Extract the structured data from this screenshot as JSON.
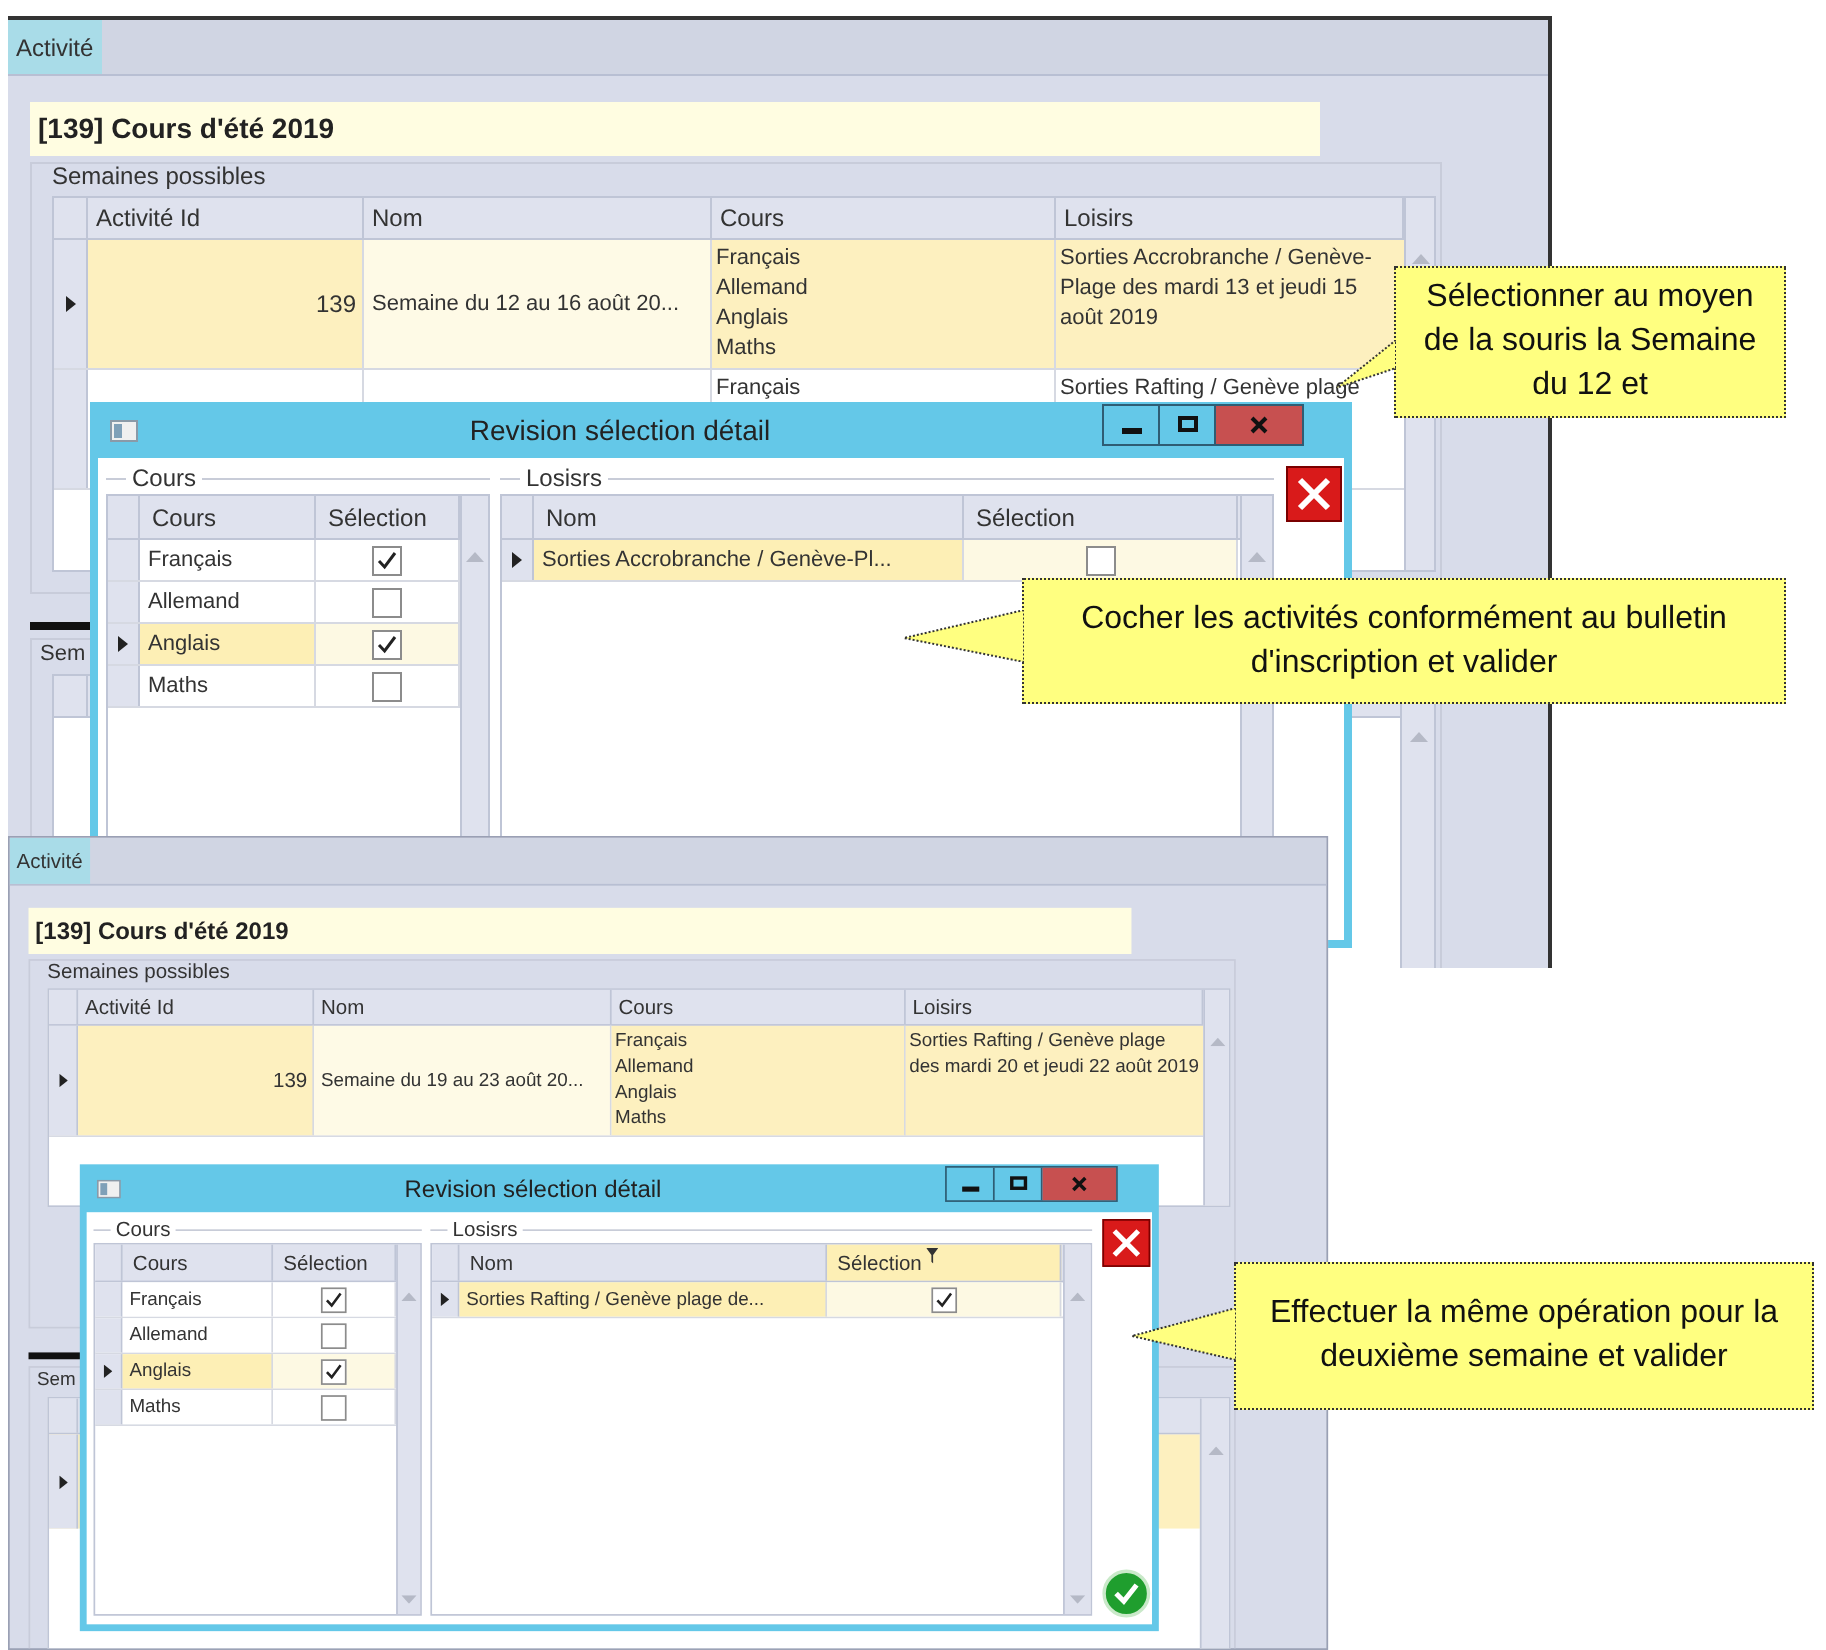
{
  "screens": [
    {
      "tab": "Activité",
      "title": "[139] Cours d'été 2019",
      "group_label": "Semaines possibles",
      "columns": [
        "Activité Id",
        "Nom",
        "Cours",
        "Loisirs"
      ],
      "rows": [
        {
          "id": "139",
          "nom": "Semaine du 12 au 16 août 20...",
          "cours": [
            "Français",
            "Allemand",
            "Anglais",
            "Maths"
          ],
          "loisirs": "Sorties Accrobranche  / Genève-Plage des mardi 13 et jeudi 15 août 2019",
          "selected": true
        },
        {
          "cours": [
            "Français"
          ],
          "loisirs": "Sorties Rafting / Genève plage",
          "selected": false
        }
      ],
      "second_group_label": "Sem",
      "dialog": {
        "title": "Revision sélection détail",
        "cours_label": "Cours",
        "cours_columns": [
          {
            "label": "Cours",
            "filtered": false
          },
          {
            "label": "Sélection",
            "filtered": false
          }
        ],
        "cours_rows": [
          {
            "name": "Français",
            "checked": true,
            "selected": false
          },
          {
            "name": "Allemand",
            "checked": false,
            "selected": false
          },
          {
            "name": "Anglais",
            "checked": true,
            "selected": true
          },
          {
            "name": "Maths",
            "checked": false,
            "selected": false
          }
        ],
        "loisirs_label": "Losisrs",
        "loisirs_columns": [
          {
            "label": "Nom",
            "filtered": false
          },
          {
            "label": "Sélection",
            "filtered": false
          }
        ],
        "loisirs_rows": [
          {
            "name": "Sorties Accrobranche  / Genève-Pl...",
            "checked": false,
            "selected": true
          }
        ],
        "validate_button": false
      }
    },
    {
      "tab": "Activité",
      "title": "[139] Cours d'été 2019",
      "group_label": "Semaines possibles",
      "columns": [
        "Activité Id",
        "Nom",
        "Cours",
        "Loisirs"
      ],
      "rows": [
        {
          "id": "139",
          "nom": "Semaine du 19 au 23 août 20...",
          "cours": [
            "Français",
            "Allemand",
            "Anglais",
            "Maths"
          ],
          "loisirs": "Sorties Rafting / Genève plage des mardi 20 et jeudi 22 août 2019",
          "selected": true
        }
      ],
      "second_group_label": "Sem",
      "lower_rows": [
        {
          "selected": true
        }
      ],
      "dialog": {
        "title": "Revision sélection détail",
        "cours_label": "Cours",
        "cours_columns": [
          {
            "label": "Cours",
            "filtered": false
          },
          {
            "label": "Sélection",
            "filtered": false
          }
        ],
        "cours_rows": [
          {
            "name": "Français",
            "checked": true,
            "selected": false
          },
          {
            "name": "Allemand",
            "checked": false,
            "selected": false
          },
          {
            "name": "Anglais",
            "checked": true,
            "selected": true
          },
          {
            "name": "Maths",
            "checked": false,
            "selected": false
          }
        ],
        "loisirs_label": "Losisrs",
        "loisirs_columns": [
          {
            "label": "Nom",
            "filtered": false
          },
          {
            "label": "Sélection",
            "filtered": true
          }
        ],
        "loisirs_rows": [
          {
            "name": "Sorties Rafting / Genève plage de...",
            "checked": true,
            "selected": true
          }
        ],
        "validate_button": true
      }
    }
  ],
  "callouts": [
    {
      "text": "Sélectionner au moyen de la souris la Semaine du 12 et"
    },
    {
      "text": "Cocher les activités conformément au bulletin d'inscription et valider"
    },
    {
      "text": "Effectuer la même opération pour la deuxième semaine et valider"
    }
  ]
}
